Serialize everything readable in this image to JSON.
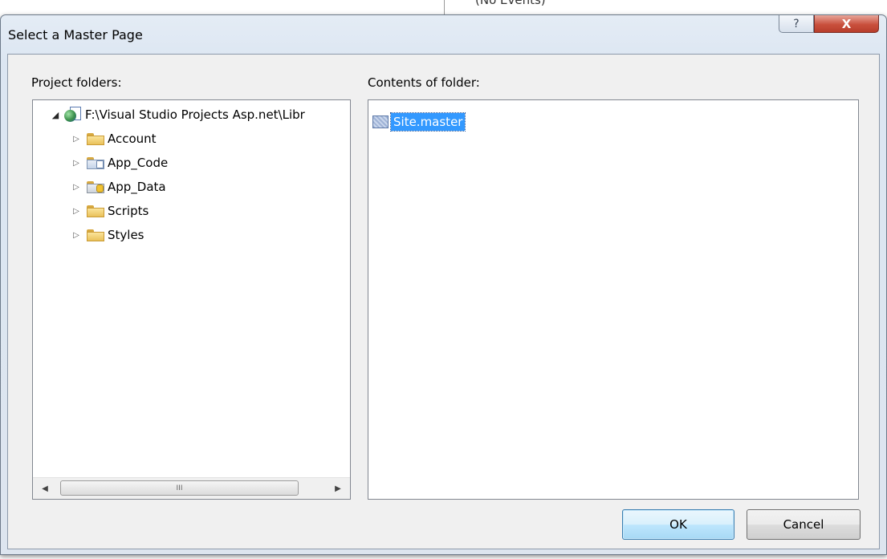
{
  "background": {
    "events_text": "(No Events)"
  },
  "dialog": {
    "title": "Select a Master Page",
    "help_glyph": "?",
    "close_glyph": "X"
  },
  "project_folders": {
    "label": "Project folders:",
    "root": {
      "expand_glyph": "◢",
      "name": "F:\\Visual Studio Projects Asp.net\\Libr"
    },
    "children": [
      {
        "name": "Account",
        "icon": "folder-icon"
      },
      {
        "name": "App_Code",
        "icon": "code-folder-icon"
      },
      {
        "name": "App_Data",
        "icon": "data-folder-icon"
      },
      {
        "name": "Scripts",
        "icon": "folder-icon"
      },
      {
        "name": "Styles",
        "icon": "folder-icon"
      }
    ],
    "collapsed_glyph": "▷",
    "scroll": {
      "left": "◀",
      "thumb": "III",
      "right": "▶"
    }
  },
  "contents": {
    "label": "Contents of folder:",
    "items": [
      {
        "name": "Site.master",
        "selected": true
      }
    ]
  },
  "buttons": {
    "ok": "OK",
    "cancel": "Cancel"
  }
}
